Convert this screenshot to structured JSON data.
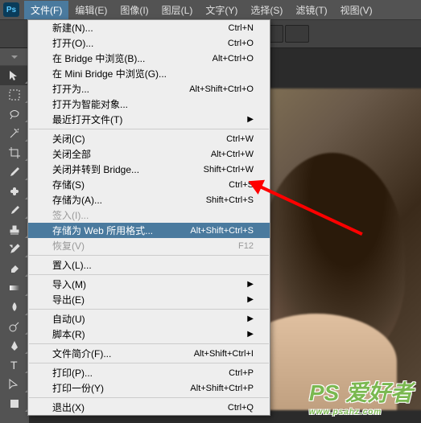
{
  "menubar": {
    "items": [
      {
        "label": "文件(F)"
      },
      {
        "label": "编辑(E)"
      },
      {
        "label": "图像(I)"
      },
      {
        "label": "图层(L)"
      },
      {
        "label": "文字(Y)"
      },
      {
        "label": "选择(S)"
      },
      {
        "label": "滤镜(T)"
      },
      {
        "label": "视图(V)"
      }
    ],
    "logo": "Ps"
  },
  "dropdown": {
    "groups": [
      [
        {
          "label": "新建(N)...",
          "shortcut": "Ctrl+N",
          "enabled": true
        },
        {
          "label": "打开(O)...",
          "shortcut": "Ctrl+O",
          "enabled": true
        },
        {
          "label": "在 Bridge 中浏览(B)...",
          "shortcut": "Alt+Ctrl+O",
          "enabled": true
        },
        {
          "label": "在 Mini Bridge 中浏览(G)...",
          "shortcut": "",
          "enabled": true
        },
        {
          "label": "打开为...",
          "shortcut": "Alt+Shift+Ctrl+O",
          "enabled": true
        },
        {
          "label": "打开为智能对象...",
          "shortcut": "",
          "enabled": true
        },
        {
          "label": "最近打开文件(T)",
          "shortcut": "",
          "enabled": true,
          "submenu": true
        }
      ],
      [
        {
          "label": "关闭(C)",
          "shortcut": "Ctrl+W",
          "enabled": true
        },
        {
          "label": "关闭全部",
          "shortcut": "Alt+Ctrl+W",
          "enabled": true
        },
        {
          "label": "关闭并转到 Bridge...",
          "shortcut": "Shift+Ctrl+W",
          "enabled": true
        },
        {
          "label": "存储(S)",
          "shortcut": "Ctrl+S",
          "enabled": true
        },
        {
          "label": "存储为(A)...",
          "shortcut": "Shift+Ctrl+S",
          "enabled": true
        },
        {
          "label": "签入(I)...",
          "shortcut": "",
          "enabled": false
        },
        {
          "label": "存储为 Web 所用格式...",
          "shortcut": "Alt+Shift+Ctrl+S",
          "enabled": true,
          "highlighted": true
        },
        {
          "label": "恢复(V)",
          "shortcut": "F12",
          "enabled": false
        }
      ],
      [
        {
          "label": "置入(L)...",
          "shortcut": "",
          "enabled": true
        }
      ],
      [
        {
          "label": "导入(M)",
          "shortcut": "",
          "enabled": true,
          "submenu": true
        },
        {
          "label": "导出(E)",
          "shortcut": "",
          "enabled": true,
          "submenu": true
        }
      ],
      [
        {
          "label": "自动(U)",
          "shortcut": "",
          "enabled": true,
          "submenu": true
        },
        {
          "label": "脚本(R)",
          "shortcut": "",
          "enabled": true,
          "submenu": true
        }
      ],
      [
        {
          "label": "文件简介(F)...",
          "shortcut": "Alt+Shift+Ctrl+I",
          "enabled": true
        }
      ],
      [
        {
          "label": "打印(P)...",
          "shortcut": "Ctrl+P",
          "enabled": true
        },
        {
          "label": "打印一份(Y)",
          "shortcut": "Alt+Shift+Ctrl+P",
          "enabled": true
        }
      ],
      [
        {
          "label": "退出(X)",
          "shortcut": "Ctrl+Q",
          "enabled": true
        }
      ]
    ]
  },
  "tools": [
    "move",
    "marquee",
    "lasso",
    "wand",
    "crop",
    "eyedropper",
    "healing",
    "brush",
    "stamp",
    "history",
    "eraser",
    "gradient",
    "blur",
    "dodge",
    "pen",
    "type",
    "path",
    "rectangle"
  ],
  "watermark": {
    "main": "PS 爱好者",
    "sub": "www.psahz.com"
  }
}
